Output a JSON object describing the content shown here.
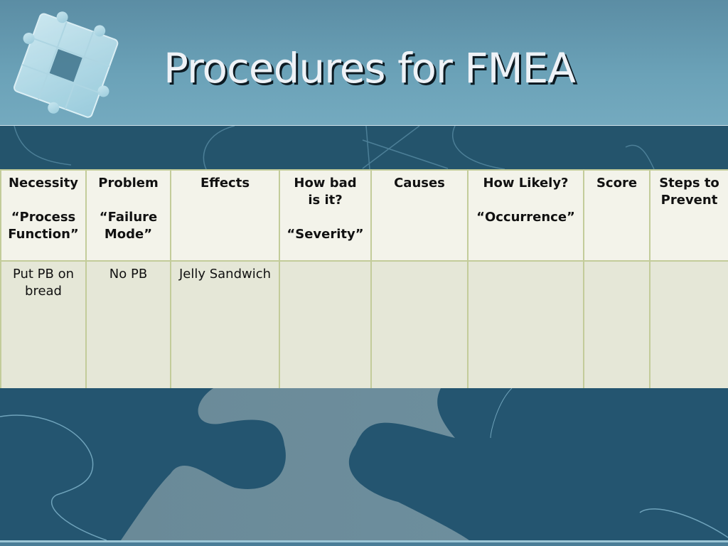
{
  "slide": {
    "title": "Procedures for FMEA",
    "decoration": "puzzle-pieces-icon"
  },
  "table": {
    "headers": [
      {
        "lines": [
          "Necessity",
          "",
          "“Process",
          "Function”"
        ]
      },
      {
        "lines": [
          "Problem",
          "",
          "“Failure",
          "Mode”"
        ]
      },
      {
        "lines": [
          "Effects"
        ]
      },
      {
        "lines": [
          "How bad",
          "is it?",
          "",
          "“Severity”"
        ]
      },
      {
        "lines": [
          "Causes"
        ]
      },
      {
        "lines": [
          "How Likely?",
          "",
          "“Occurrence”"
        ]
      },
      {
        "lines": [
          "Score"
        ]
      },
      {
        "lines": [
          "Steps to",
          "Prevent"
        ]
      }
    ],
    "rows": [
      {
        "cells": [
          {
            "lines": [
              "Put PB on",
              "bread"
            ]
          },
          {
            "lines": [
              "No PB"
            ]
          },
          {
            "lines": [
              "Jelly Sandwich"
            ]
          },
          {
            "lines": [
              ""
            ]
          },
          {
            "lines": [
              ""
            ]
          },
          {
            "lines": [
              ""
            ]
          },
          {
            "lines": [
              ""
            ]
          },
          {
            "lines": [
              ""
            ]
          }
        ]
      }
    ]
  },
  "colors": {
    "header_bg": "#6ba2b8",
    "band_bg": "#24546c",
    "table_border": "#c3cc9a",
    "table_head_bg": "#f3f3ea",
    "table_row_bg": "#e5e7d7",
    "title_color": "#eef2f7"
  }
}
